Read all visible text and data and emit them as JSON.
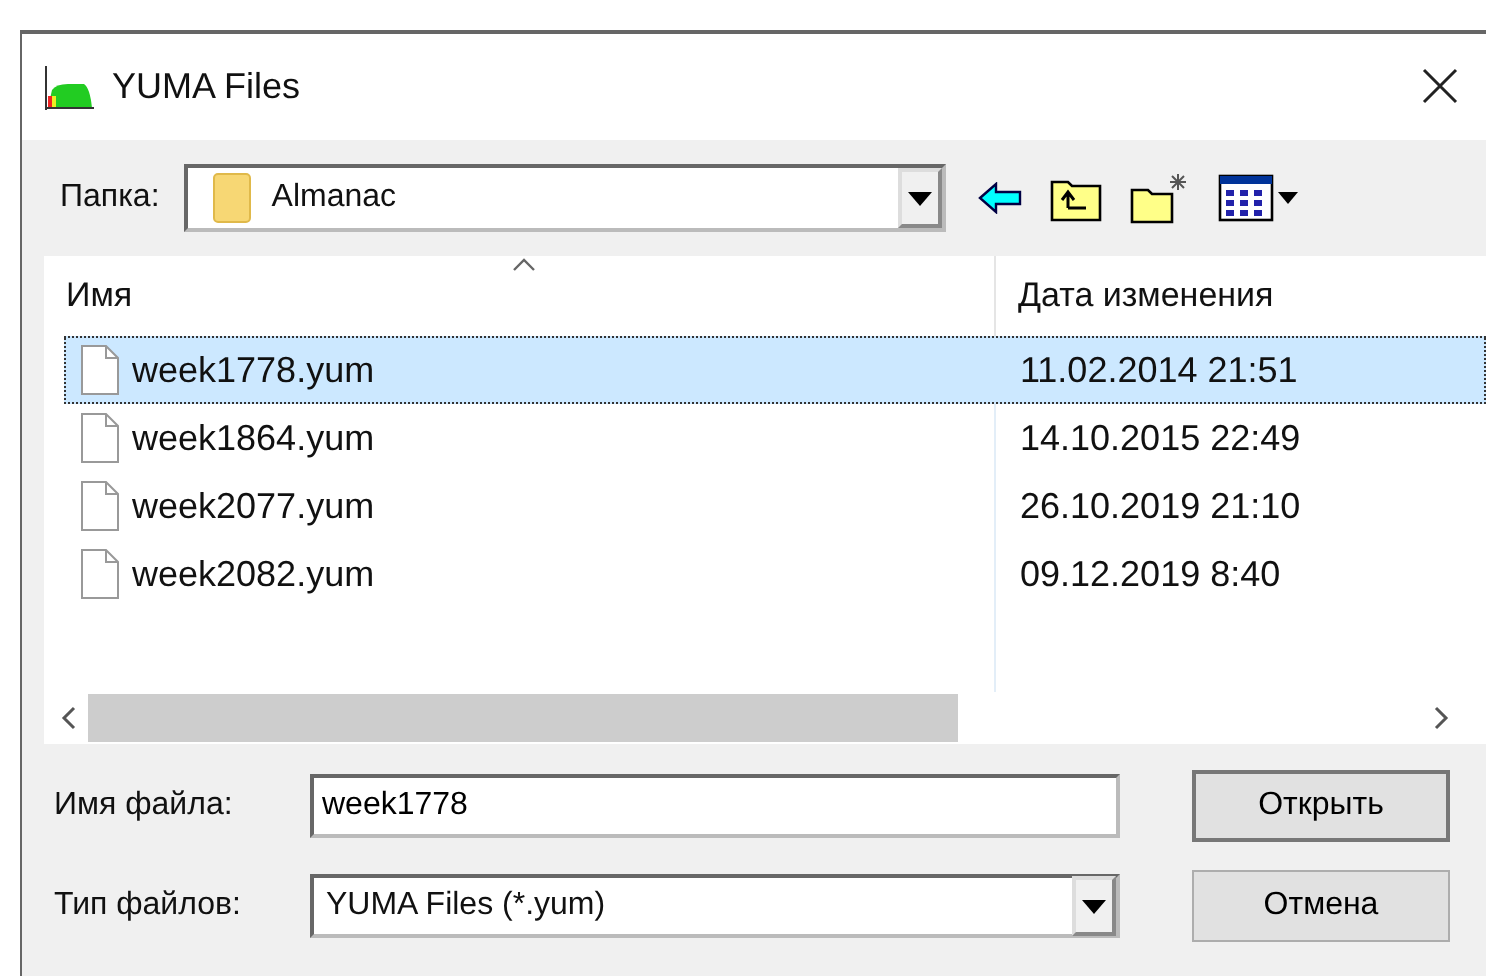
{
  "window": {
    "title": "YUMA Files"
  },
  "folder": {
    "label": "Папка:",
    "value": "Almanac"
  },
  "list": {
    "columns": [
      {
        "label": "Имя",
        "sorted": true
      },
      {
        "label": "Дата изменения",
        "sorted": false
      }
    ],
    "rows": [
      {
        "name": "week1778.yum",
        "date": "11.02.2014 21:51",
        "selected": true
      },
      {
        "name": "week1864.yum",
        "date": "14.10.2015 22:49",
        "selected": false
      },
      {
        "name": "week2077.yum",
        "date": "26.10.2019 21:10",
        "selected": false
      },
      {
        "name": "week2082.yum",
        "date": "09.12.2019 8:40",
        "selected": false
      }
    ]
  },
  "filename": {
    "label": "Имя файла:",
    "value": "week1778"
  },
  "filetype": {
    "label": "Тип файлов:",
    "value": "YUMA Files (*.yum)"
  },
  "buttons": [
    "Открыть",
    "Отмена"
  ]
}
